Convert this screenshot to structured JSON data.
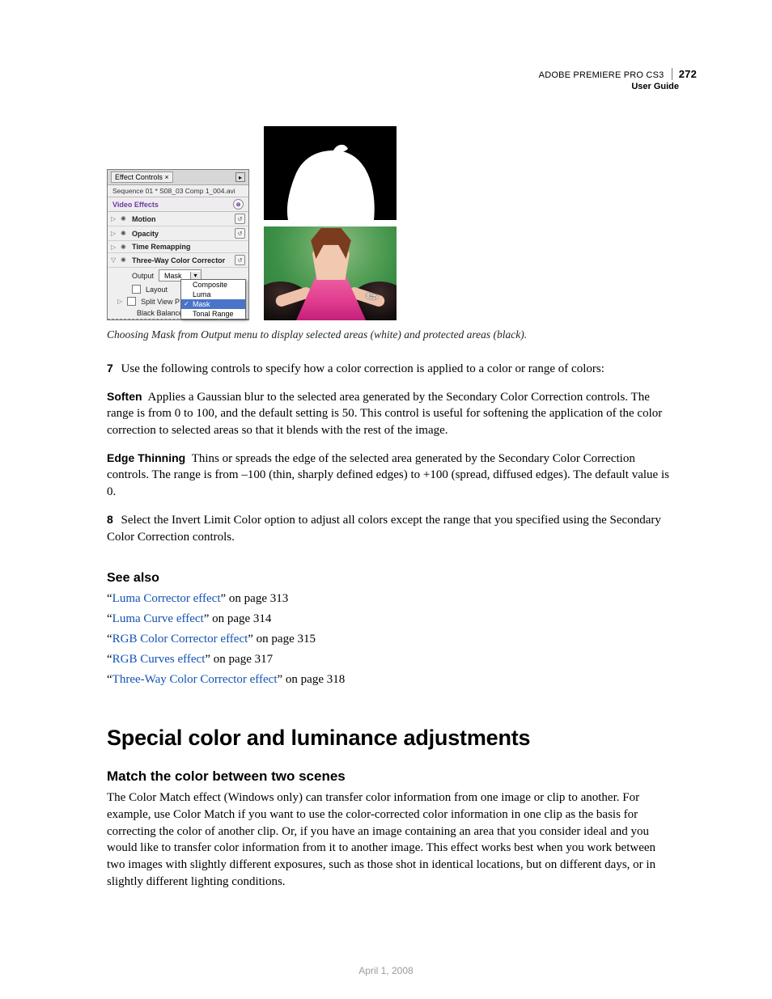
{
  "header": {
    "product": "ADOBE PREMIERE PRO CS3",
    "guide": "User Guide",
    "page_number": "272"
  },
  "figure": {
    "panel": {
      "tab_label": "Effect Controls ×",
      "sequence_line": "Sequence 01 * S08_03 Comp 1_004.avi",
      "section_header": "Video Effects",
      "effects": [
        {
          "name": "Motion"
        },
        {
          "name": "Opacity"
        },
        {
          "name": "Time Remapping"
        },
        {
          "name": "Three-Way Color Corrector"
        }
      ],
      "output_label": "Output",
      "output_value": "Mask",
      "output_menu": [
        "Composite",
        "Luma",
        "Mask",
        "Tonal Range"
      ],
      "layout_label": "Layout",
      "split_label": "Split View P",
      "black_balance_label": "Black Balance"
    },
    "caption": "Choosing Mask from Output menu to display selected areas (white) and protected areas (black)."
  },
  "steps": {
    "seven": {
      "num": "7",
      "text": "Use the following controls to specify how a color correction is applied to a color or range of colors:"
    },
    "soften": {
      "term": "Soften",
      "text": "Applies a Gaussian blur to the selected area generated by the Secondary Color Correction controls. The range is from 0 to 100, and the default setting is 50. This control is useful for softening the application of the color correction to selected areas so that it blends with the rest of the image."
    },
    "edge": {
      "term": "Edge Thinning",
      "text": "Thins or spreads the edge of the selected area generated by the Secondary Color Correction controls. The range is from –100 (thin, sharply defined edges) to +100 (spread, diffused edges). The default value is 0."
    },
    "eight": {
      "num": "8",
      "text": "Select the Invert Limit Color option to adjust all colors except the range that you specified using the Secondary Color Correction controls."
    }
  },
  "see_also": {
    "heading": "See also",
    "items": [
      {
        "link": "Luma Corrector effect",
        "suffix": "” on page 313"
      },
      {
        "link": "Luma Curve effect",
        "suffix": "” on page 314"
      },
      {
        "link": "RGB Color Corrector effect",
        "suffix": "” on page 315"
      },
      {
        "link": "RGB Curves effect",
        "suffix": "” on page 317"
      },
      {
        "link": "Three-Way Color Corrector effect",
        "suffix": "” on page 318"
      }
    ],
    "open_quote": "“"
  },
  "section": {
    "title": "Special color and luminance adjustments",
    "sub_title": "Match the color between two scenes",
    "body": "The Color Match effect (Windows only) can transfer color information from one image or clip to another. For example, use Color Match if you want to use the color-corrected color information in one clip as the basis for correcting the color of another clip. Or, if you have an image containing an area that you consider ideal and you would like to transfer color information from it to another image. This effect works best when you work between two images with slightly different exposures, such as those shot in identical locations, but on different days, or in slightly different lighting conditions."
  },
  "footer_date": "April 1, 2008"
}
